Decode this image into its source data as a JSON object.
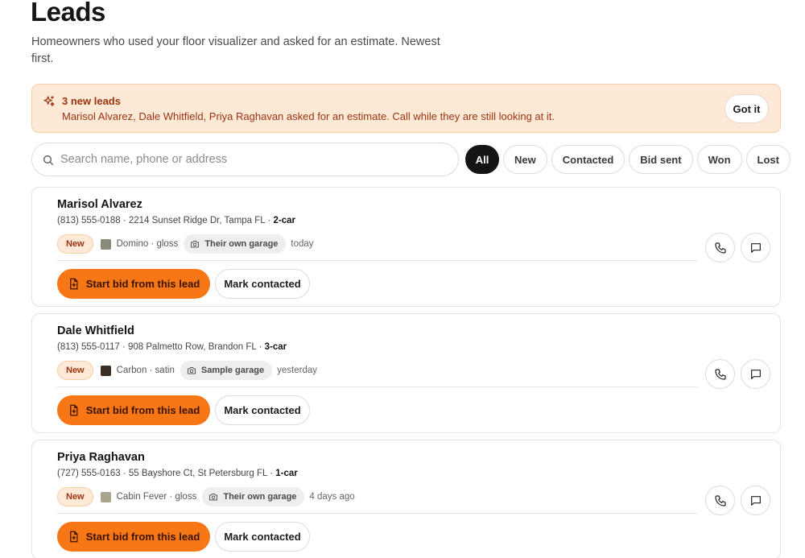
{
  "page": {
    "title": "Leads",
    "subtitle": "Homeowners who used your floor visualizer and asked for an estimate. Newest first."
  },
  "banner": {
    "title": "3 new leads",
    "text": "Marisol Alvarez, Dale Whitfield, Priya Raghavan asked for an estimate. Call while they are still looking at it.",
    "dismiss_label": "Got it",
    "icon": "sparkle-icon"
  },
  "search": {
    "placeholder": "Search name, phone or address",
    "value": ""
  },
  "filters": [
    {
      "label": "All",
      "active": true
    },
    {
      "label": "New",
      "active": false
    },
    {
      "label": "Contacted",
      "active": false
    },
    {
      "label": "Bid sent",
      "active": false
    },
    {
      "label": "Won",
      "active": false
    },
    {
      "label": "Lost",
      "active": false
    }
  ],
  "leads": [
    {
      "name": "Marisol Alvarez",
      "contact": "(813) 555-0188 · 2214 Sunset Ridge Dr, Tampa FL · ",
      "garage_size": "2-car",
      "status": "New",
      "swatch_color": "#8a8a78",
      "finish": "Domino · gloss",
      "photo_source": "Their own garage",
      "when": "today",
      "bid_label": "Start bid from this lead",
      "contacted_label": "Mark contacted"
    },
    {
      "name": "Dale Whitfield",
      "contact": "(813) 555-0117 · 908 Palmetto Row, Brandon FL · ",
      "garage_size": "3-car",
      "status": "New",
      "swatch_color": "#3a3025",
      "finish": "Carbon · satin",
      "photo_source": "Sample garage",
      "when": "yesterday",
      "bid_label": "Start bid from this lead",
      "contacted_label": "Mark contacted"
    },
    {
      "name": "Priya Raghavan",
      "contact": "(727) 555-0163 · 55 Bayshore Ct, St Petersburg FL · ",
      "garage_size": "1-car",
      "status": "New",
      "swatch_color": "#a9a48c",
      "finish": "Cabin Fever · gloss",
      "photo_source": "Their own garage",
      "when": "4 days ago",
      "bid_label": "Start bid from this lead",
      "contacted_label": "Mark contacted"
    }
  ],
  "colors": {
    "accent": "#f77717",
    "banner_bg": "#fde9d6",
    "banner_text": "#9a3412",
    "active_chip": "#141414"
  }
}
